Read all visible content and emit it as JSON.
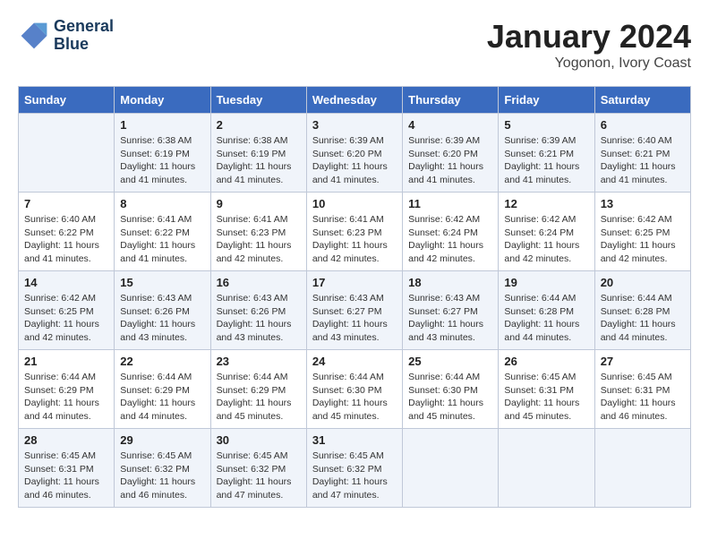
{
  "header": {
    "logo_line1": "General",
    "logo_line2": "Blue",
    "month": "January 2024",
    "location": "Yogonon, Ivory Coast"
  },
  "weekdays": [
    "Sunday",
    "Monday",
    "Tuesday",
    "Wednesday",
    "Thursday",
    "Friday",
    "Saturday"
  ],
  "weeks": [
    [
      {
        "day": "",
        "info": ""
      },
      {
        "day": "1",
        "info": "Sunrise: 6:38 AM\nSunset: 6:19 PM\nDaylight: 11 hours and 41 minutes."
      },
      {
        "day": "2",
        "info": "Sunrise: 6:38 AM\nSunset: 6:19 PM\nDaylight: 11 hours and 41 minutes."
      },
      {
        "day": "3",
        "info": "Sunrise: 6:39 AM\nSunset: 6:20 PM\nDaylight: 11 hours and 41 minutes."
      },
      {
        "day": "4",
        "info": "Sunrise: 6:39 AM\nSunset: 6:20 PM\nDaylight: 11 hours and 41 minutes."
      },
      {
        "day": "5",
        "info": "Sunrise: 6:39 AM\nSunset: 6:21 PM\nDaylight: 11 hours and 41 minutes."
      },
      {
        "day": "6",
        "info": "Sunrise: 6:40 AM\nSunset: 6:21 PM\nDaylight: 11 hours and 41 minutes."
      }
    ],
    [
      {
        "day": "7",
        "info": "Sunrise: 6:40 AM\nSunset: 6:22 PM\nDaylight: 11 hours and 41 minutes."
      },
      {
        "day": "8",
        "info": "Sunrise: 6:41 AM\nSunset: 6:22 PM\nDaylight: 11 hours and 41 minutes."
      },
      {
        "day": "9",
        "info": "Sunrise: 6:41 AM\nSunset: 6:23 PM\nDaylight: 11 hours and 42 minutes."
      },
      {
        "day": "10",
        "info": "Sunrise: 6:41 AM\nSunset: 6:23 PM\nDaylight: 11 hours and 42 minutes."
      },
      {
        "day": "11",
        "info": "Sunrise: 6:42 AM\nSunset: 6:24 PM\nDaylight: 11 hours and 42 minutes."
      },
      {
        "day": "12",
        "info": "Sunrise: 6:42 AM\nSunset: 6:24 PM\nDaylight: 11 hours and 42 minutes."
      },
      {
        "day": "13",
        "info": "Sunrise: 6:42 AM\nSunset: 6:25 PM\nDaylight: 11 hours and 42 minutes."
      }
    ],
    [
      {
        "day": "14",
        "info": "Sunrise: 6:42 AM\nSunset: 6:25 PM\nDaylight: 11 hours and 42 minutes."
      },
      {
        "day": "15",
        "info": "Sunrise: 6:43 AM\nSunset: 6:26 PM\nDaylight: 11 hours and 43 minutes."
      },
      {
        "day": "16",
        "info": "Sunrise: 6:43 AM\nSunset: 6:26 PM\nDaylight: 11 hours and 43 minutes."
      },
      {
        "day": "17",
        "info": "Sunrise: 6:43 AM\nSunset: 6:27 PM\nDaylight: 11 hours and 43 minutes."
      },
      {
        "day": "18",
        "info": "Sunrise: 6:43 AM\nSunset: 6:27 PM\nDaylight: 11 hours and 43 minutes."
      },
      {
        "day": "19",
        "info": "Sunrise: 6:44 AM\nSunset: 6:28 PM\nDaylight: 11 hours and 44 minutes."
      },
      {
        "day": "20",
        "info": "Sunrise: 6:44 AM\nSunset: 6:28 PM\nDaylight: 11 hours and 44 minutes."
      }
    ],
    [
      {
        "day": "21",
        "info": "Sunrise: 6:44 AM\nSunset: 6:29 PM\nDaylight: 11 hours and 44 minutes."
      },
      {
        "day": "22",
        "info": "Sunrise: 6:44 AM\nSunset: 6:29 PM\nDaylight: 11 hours and 44 minutes."
      },
      {
        "day": "23",
        "info": "Sunrise: 6:44 AM\nSunset: 6:29 PM\nDaylight: 11 hours and 45 minutes."
      },
      {
        "day": "24",
        "info": "Sunrise: 6:44 AM\nSunset: 6:30 PM\nDaylight: 11 hours and 45 minutes."
      },
      {
        "day": "25",
        "info": "Sunrise: 6:44 AM\nSunset: 6:30 PM\nDaylight: 11 hours and 45 minutes."
      },
      {
        "day": "26",
        "info": "Sunrise: 6:45 AM\nSunset: 6:31 PM\nDaylight: 11 hours and 45 minutes."
      },
      {
        "day": "27",
        "info": "Sunrise: 6:45 AM\nSunset: 6:31 PM\nDaylight: 11 hours and 46 minutes."
      }
    ],
    [
      {
        "day": "28",
        "info": "Sunrise: 6:45 AM\nSunset: 6:31 PM\nDaylight: 11 hours and 46 minutes."
      },
      {
        "day": "29",
        "info": "Sunrise: 6:45 AM\nSunset: 6:32 PM\nDaylight: 11 hours and 46 minutes."
      },
      {
        "day": "30",
        "info": "Sunrise: 6:45 AM\nSunset: 6:32 PM\nDaylight: 11 hours and 47 minutes."
      },
      {
        "day": "31",
        "info": "Sunrise: 6:45 AM\nSunset: 6:32 PM\nDaylight: 11 hours and 47 minutes."
      },
      {
        "day": "",
        "info": ""
      },
      {
        "day": "",
        "info": ""
      },
      {
        "day": "",
        "info": ""
      }
    ]
  ]
}
